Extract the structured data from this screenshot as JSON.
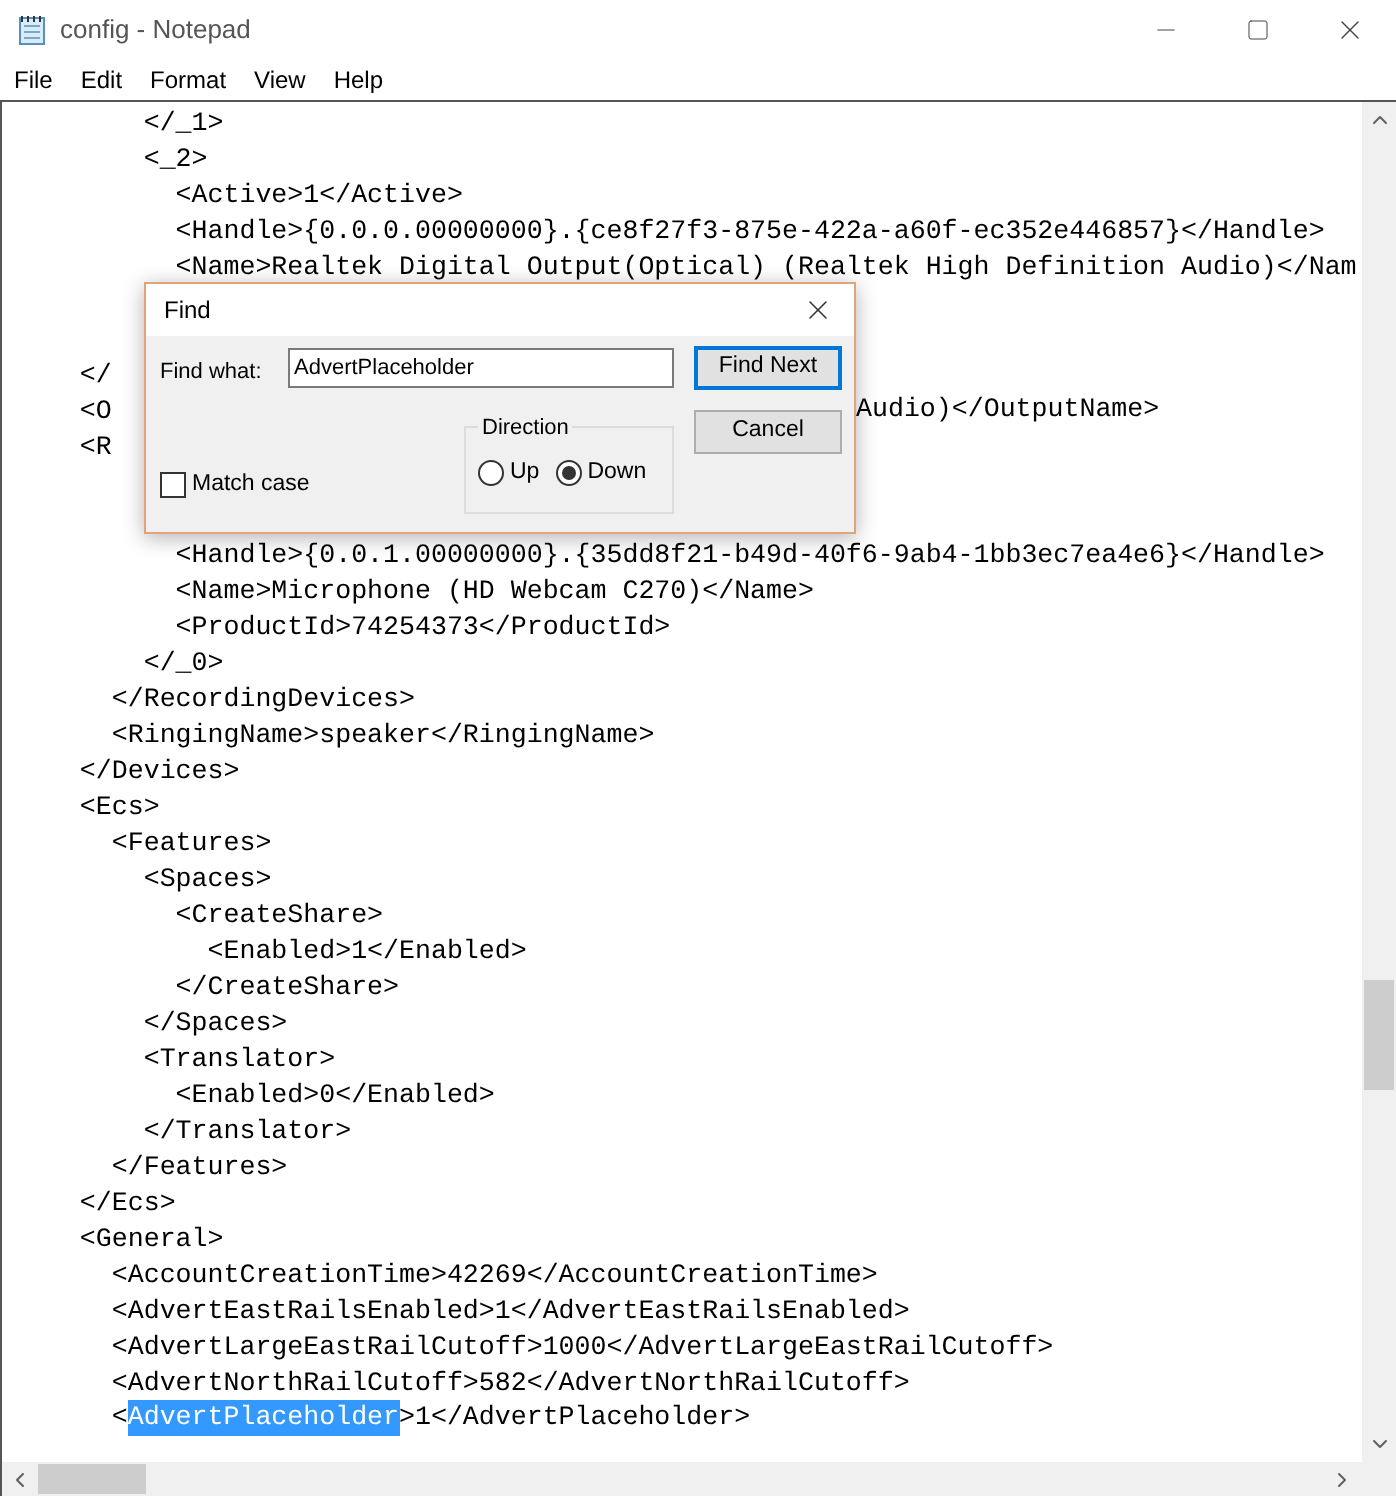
{
  "window": {
    "title": "config - Notepad"
  },
  "menu": [
    "File",
    "Edit",
    "Format",
    "View",
    "Help"
  ],
  "lines_above": [
    "        </_1>",
    "        <_2>",
    "          <Active>1</Active>",
    "          <Handle>{0.0.0.00000000}.{ce8f27f3-875e-422a-a60f-ec352e446857}</Handle>",
    "          <Name>Realtek Digital Output(Optical) (Realtek High Definition Audio)</Nam"
  ],
  "lines_beside": [
    {
      "left": "    </"
    },
    {
      "left": "    <O",
      "right": "Audio)</OutputName>"
    },
    {
      "left": "    <R"
    }
  ],
  "lines_below": [
    "          <Handle>{0.0.1.00000000}.{35dd8f21-b49d-40f6-9ab4-1bb3ec7ea4e6}</Handle>",
    "          <Name>Microphone (HD Webcam C270)</Name>",
    "          <ProductId>74254373</ProductId>",
    "        </_0>",
    "      </RecordingDevices>",
    "      <RingingName>speaker</RingingName>",
    "    </Devices>",
    "    <Ecs>",
    "      <Features>",
    "        <Spaces>",
    "          <CreateShare>",
    "            <Enabled>1</Enabled>",
    "          </CreateShare>",
    "        </Spaces>",
    "        <Translator>",
    "          <Enabled>0</Enabled>",
    "        </Translator>",
    "      </Features>",
    "    </Ecs>",
    "    <General>",
    "      <AccountCreationTime>42269</AccountCreationTime>",
    "      <AdvertEastRailsEnabled>1</AdvertEastRailsEnabled>",
    "      <AdvertLargeEastRailCutoff>1000</AdvertLargeEastRailCutoff>",
    "      <AdvertNorthRailCutoff>582</AdvertNorthRailCutoff>"
  ],
  "last_line": {
    "before": "      <",
    "selection": "AdvertPlaceholder",
    "after": ">1</AdvertPlaceholder>"
  },
  "find_dialog": {
    "title": "Find",
    "find_label": "Find what:",
    "find_value": "AdvertPlaceholder",
    "buttons": [
      {
        "label": "Find Next",
        "default": true
      },
      {
        "label": "Cancel",
        "default": false
      }
    ],
    "match_case": {
      "label": "Match case",
      "checked": false
    },
    "direction": {
      "label": "Direction",
      "options": [
        {
          "label": "Up",
          "selected": false
        },
        {
          "label": "Down",
          "selected": true
        }
      ]
    }
  }
}
